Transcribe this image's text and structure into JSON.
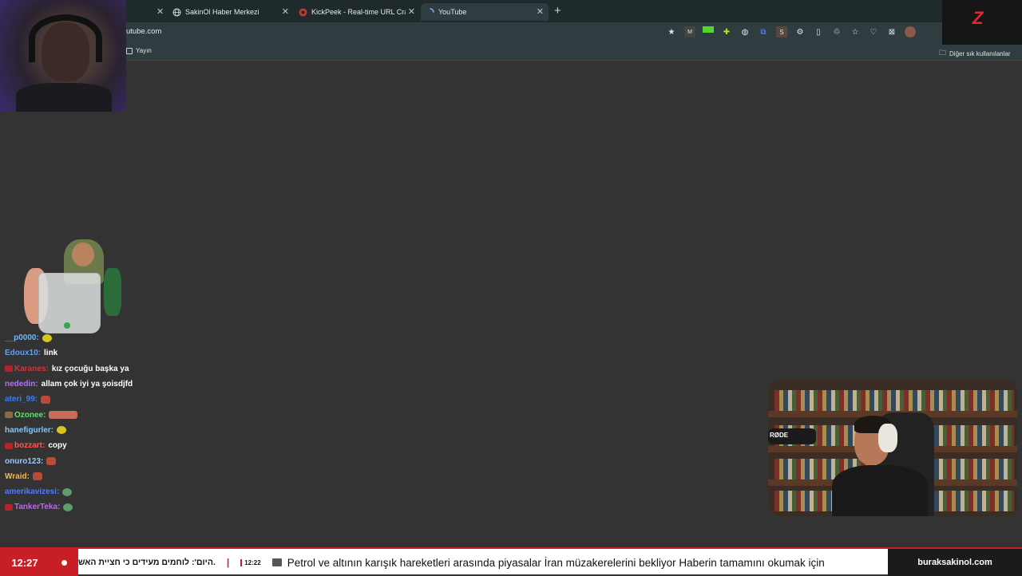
{
  "browser": {
    "tabs": [
      {
        "title": "SakinOl Haber Merkezi",
        "icon": "globe-icon"
      },
      {
        "title": "KickPeek - Real-time URL Crawler",
        "icon": "kickpeek-icon"
      },
      {
        "title": "YouTube",
        "icon": "loading-icon"
      }
    ],
    "url": "utube.com",
    "bookmarks": [
      {
        "label": "Yayın"
      },
      {
        "label": "Diğer sık kullanılanlar"
      }
    ]
  },
  "stream": {
    "chat": [
      {
        "user": "__p0000:",
        "text": "",
        "color": "#6db7ff",
        "emote": "yellow"
      },
      {
        "user": "Edoux10:",
        "text": "link",
        "color": "#5aa0ff"
      },
      {
        "user": "Karanes:",
        "text": "kız çocuğu başka ya",
        "color": "#d3353a",
        "badge": true
      },
      {
        "user": "nededin:",
        "text": "allam çok iyi ya şoisdjfd",
        "color": "#b86cff"
      },
      {
        "user": "ateri_99:",
        "text": "",
        "color": "#3b7bff",
        "emote": "brown"
      },
      {
        "user": "Ozonee:",
        "text": "",
        "color": "#61e06a",
        "emote": "wide",
        "badge": true
      },
      {
        "user": "hanefigurler:",
        "text": "",
        "color": "#7ec7ff",
        "emote": "yellow"
      },
      {
        "user": "bozzart:",
        "text": "copy",
        "color": "#ff5a5a",
        "badge": true
      },
      {
        "user": "onuro123:",
        "text": "",
        "color": "#9dc6ff",
        "emote": "brown"
      },
      {
        "user": "Wraid:",
        "text": "",
        "color": "#ffb640",
        "emote": "brown"
      },
      {
        "user": "amerikavizesi:",
        "text": "",
        "color": "#4f7cff",
        "emote": "green"
      },
      {
        "user": "TankerTeka:",
        "text": "",
        "color": "#c060ff",
        "emote": "green",
        "badge": true
      }
    ],
    "overlay_labels": {
      "mic_brand": "RØDE",
      "logo": "Z"
    }
  },
  "ticker": {
    "clock": "12:27",
    "hebrew": ".היום': לוחמים מעידים כי חציית האש",
    "separator": "|",
    "time2": "12:22",
    "headline": "Petrol ve altının karışık hareketleri arasında piyasalar İran müzakerelerini bekliyor Haberin tamamını okumak için",
    "site": "buraksakinol.com"
  },
  "colors": {
    "accent_red": "#c81e25",
    "browser_bg": "#2f3d41",
    "page_bg": "#333333"
  }
}
